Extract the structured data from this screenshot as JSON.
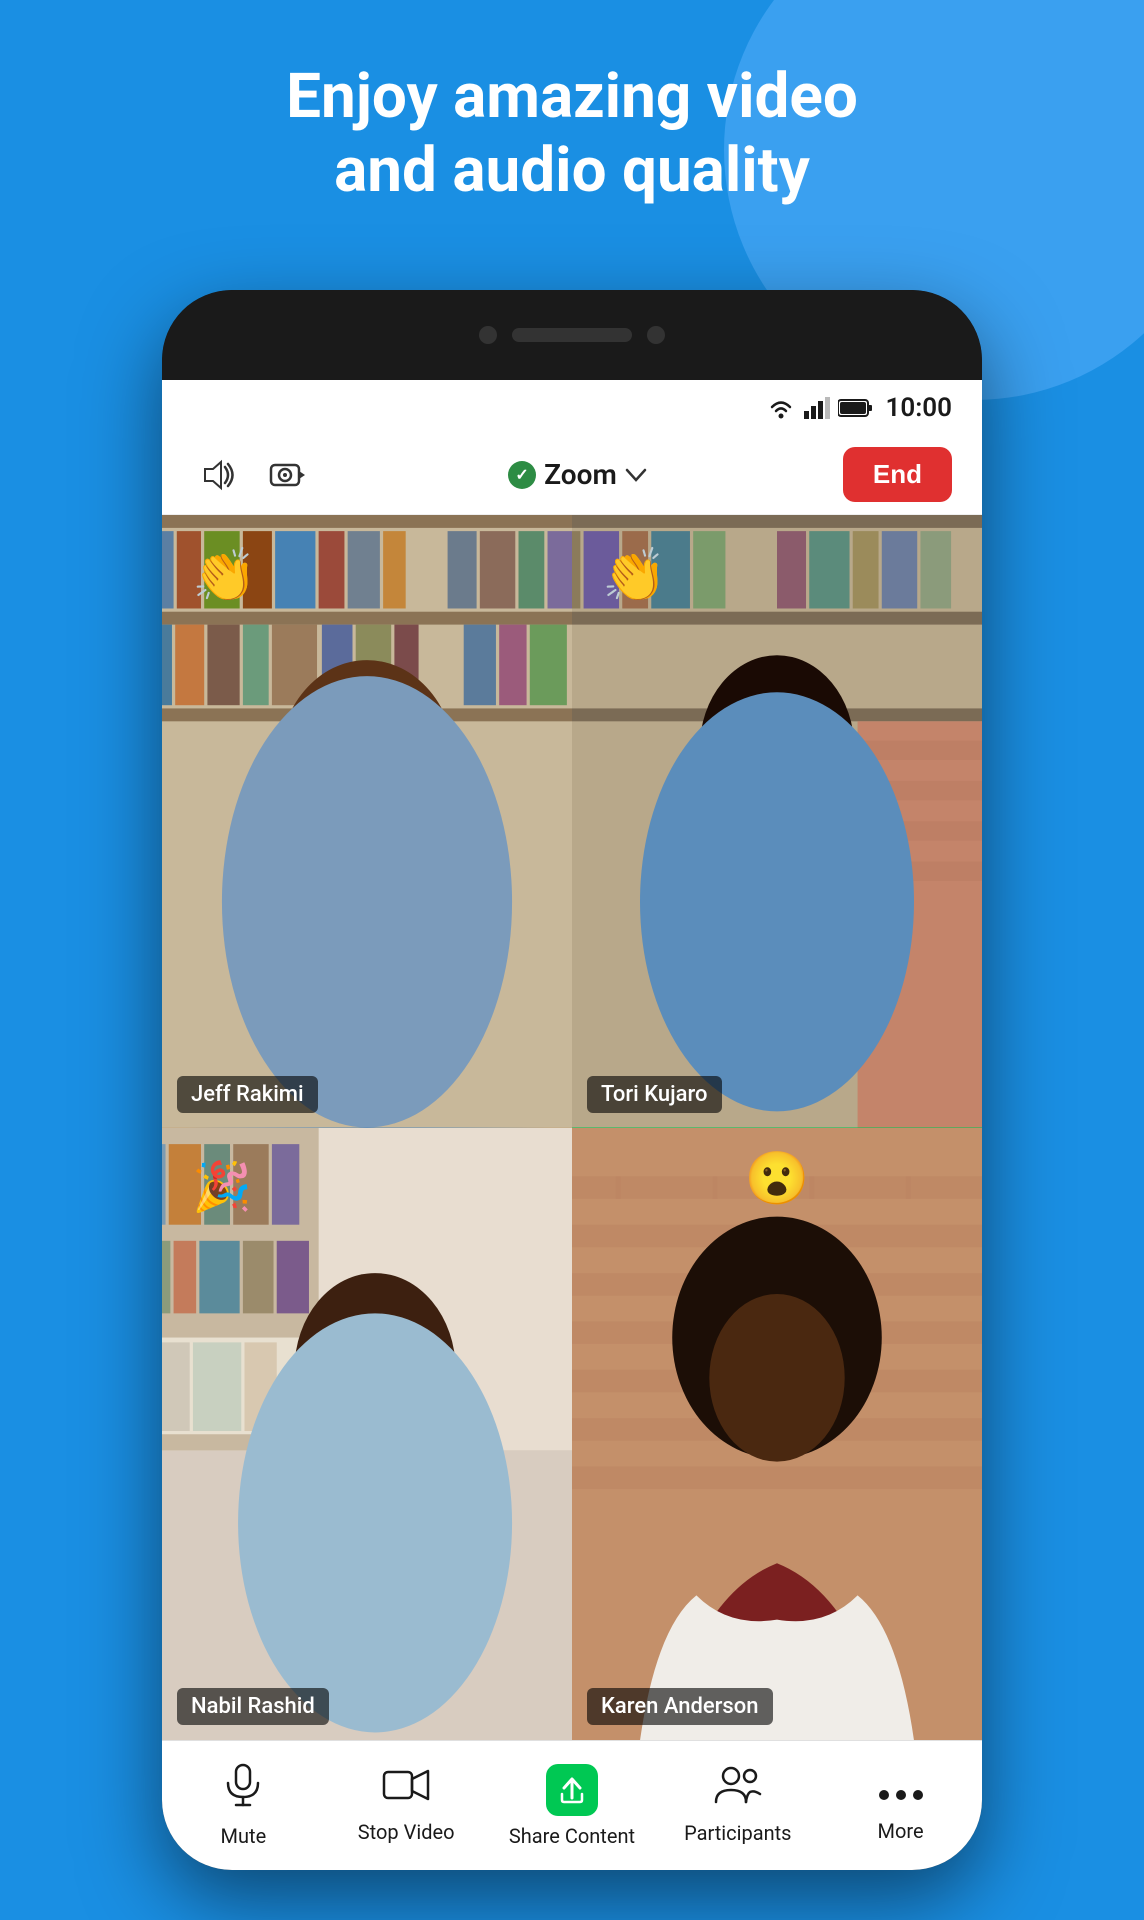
{
  "background": {
    "color": "#1a8fe3"
  },
  "headline": {
    "line1": "Enjoy amazing video",
    "line2": "and audio quality",
    "full": "Enjoy amazing video\nand audio quality"
  },
  "status_bar": {
    "time": "10:00",
    "wifi_icon": "wifi",
    "signal_icon": "signal",
    "battery_icon": "battery"
  },
  "zoom_toolbar": {
    "speaker_icon": "speaker",
    "camera_flip_icon": "camera-flip",
    "brand_name": "Zoom",
    "shield_icon": "shield-check",
    "chevron_icon": "chevron-down",
    "end_button_label": "End"
  },
  "participants": [
    {
      "name": "Jeff Rakimi",
      "emoji": "👏",
      "active_speaker": false,
      "position": "top-left"
    },
    {
      "name": "Tori Kujaro",
      "emoji": "👏",
      "active_speaker": true,
      "position": "top-right"
    },
    {
      "name": "Nabil Rashid",
      "emoji": "🎉",
      "active_speaker": false,
      "position": "bottom-left"
    },
    {
      "name": "Karen Anderson",
      "emoji": "😮",
      "active_speaker": false,
      "position": "bottom-right"
    }
  ],
  "bottom_toolbar": {
    "items": [
      {
        "id": "mute",
        "label": "Mute",
        "icon": "microphone"
      },
      {
        "id": "stop-video",
        "label": "Stop Video",
        "icon": "video-camera"
      },
      {
        "id": "share-content",
        "label": "Share Content",
        "icon": "share-arrow"
      },
      {
        "id": "participants",
        "label": "Participants",
        "icon": "people"
      },
      {
        "id": "more",
        "label": "More",
        "icon": "dots"
      }
    ]
  }
}
